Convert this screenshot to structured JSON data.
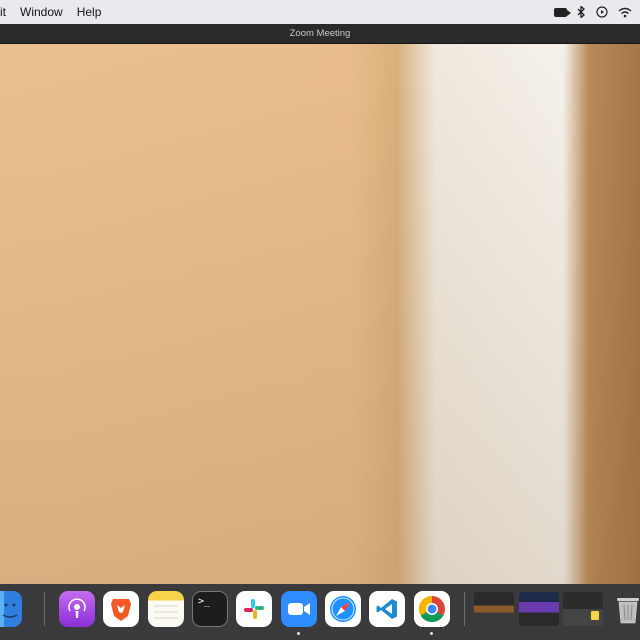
{
  "menubar": {
    "items": [
      "it",
      "Window",
      "Help"
    ],
    "status_icons": [
      "camera-icon",
      "bluetooth-icon",
      "screen-record-icon",
      "wifi-icon"
    ]
  },
  "window": {
    "title": "Zoom Meeting"
  },
  "video": {
    "description_icon": "participant-video-feed"
  },
  "dock": {
    "apps": [
      "finder-icon",
      "podcasts-icon",
      "brave-browser-icon",
      "notes-icon",
      "terminal-icon",
      "slack-icon",
      "zoom-icon",
      "safari-icon",
      "vscode-icon",
      "chrome-icon"
    ],
    "recent_windows": [
      "window-thumbnail-1",
      "window-thumbnail-2",
      "window-thumbnail-3"
    ],
    "trash": "trash-icon",
    "terminal_glyph": ">_"
  },
  "colors": {
    "menubar_bg": "#ece9ee",
    "titlebar_bg": "#2a2a2a",
    "dock_bg": "#3a3a3c"
  }
}
